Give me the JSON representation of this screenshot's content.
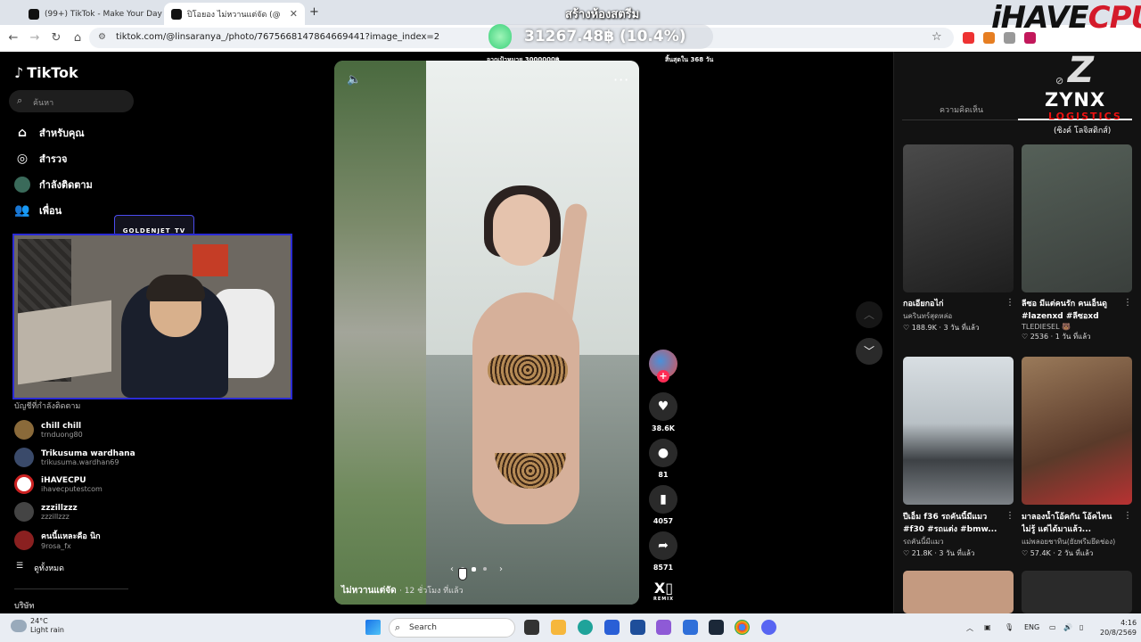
{
  "browser": {
    "tabs": [
      {
        "label": "(99+) TikTok - Make Your Day",
        "active": false
      },
      {
        "label": "ปิโอยอง ไม่หวานแต่จัด (@lins",
        "active": true
      }
    ],
    "new_tab_icon": "plus-icon",
    "url": "tiktok.com/@linsaranya_/photo/7675668147864669441?image_index=2"
  },
  "stream_overlay": {
    "donation_title": "สร้างห้องสตรีม",
    "donation_amount": "31267.48฿ (10.4%)",
    "donation_goal": "จากเป้าหมาย 3000000฿",
    "donation_deadline": "สิ้นสุดใน 368 วัน",
    "brand_main": "iHAVE",
    "brand_accent": "CPU",
    "sponsor_name": "ZYNX",
    "sponsor_sub": "LOGISTICS",
    "sponsor_thai": "(ซิงค์ โลจิสติกส์)",
    "webcam_tag": "GOLDENJET_TV"
  },
  "sidebar": {
    "logo": "TikTok",
    "search_placeholder": "ค้นหา",
    "nav": [
      {
        "label": "สำหรับคุณ",
        "icon": "home-icon"
      },
      {
        "label": "สำรวจ",
        "icon": "compass-icon"
      },
      {
        "label": "กำลังติดตาม",
        "icon": "following-avatar-icon"
      },
      {
        "label": "เพื่อน",
        "icon": "friends-icon"
      }
    ],
    "following_heading": "บัญชีที่กำลังติดตาม",
    "accounts": [
      {
        "name": "chill chill",
        "handle": "trnduong80",
        "color": "#8a6a3a"
      },
      {
        "name": "Trikusuma wardhana",
        "handle": "trikusuma.wardhan69",
        "color": "#3a4a6a"
      },
      {
        "name": "iHAVECPU",
        "handle": "ihavecputestcom",
        "color": "#ffffff"
      },
      {
        "name": "zzzillzzz",
        "handle": "zzzillzzz",
        "color": "#444444"
      },
      {
        "name": "คนนี้แหละคือ นิก",
        "handle": "9rosa_fx",
        "color": "#8a2020"
      }
    ],
    "see_all": "ดูทั้งหมด",
    "company": "บริษัท"
  },
  "post": {
    "caption_author": "ไม่หวานแต่จัด",
    "caption_time": "· 12 ชั่วโมง ที่แล้ว",
    "slide_count": 3,
    "slide_active": 1,
    "likes": "38.6K",
    "comments": "81",
    "bookmarks": "4057",
    "shares": "8571",
    "remix_label": "REMIX"
  },
  "right_panel": {
    "tab_comments": "ความคิดเห็น",
    "videos": [
      {
        "title": "กอเอียกอไก่",
        "author": "นครินทร์สุดหล่อ",
        "stats": "♡ 188.9K · 3 วัน ที่แล้ว",
        "colors": [
          "#2d2d2d",
          "#555"
        ]
      },
      {
        "title": "ลีซอ มีแต่คนรัก คนเอ็นดู #lazenxd #ลีซอxd #มา...",
        "author": "TLEDIESEL 🐻",
        "stats": "♡ 2536 · 1 วัน ที่แล้ว",
        "colors": [
          "#3f4a44",
          "#6a6a6a"
        ]
      },
      {
        "title": "ปีเอ็ม f36 รถคันนี้มีแมว #f30 #รถแต่ง #bmw...",
        "author": "รถคันนี้มีแมว",
        "stats": "♡ 21.8K · 3 วัน ที่แล้ว",
        "colors": [
          "#c9d4dc",
          "#4a4e52"
        ]
      },
      {
        "title": "มาลองน้ำโอ้คกัน โอ้คไหนไม่รู้ แต่ได้มาแล้ว...",
        "author": "แม่พลอยชาทิน(ยัยพรีมยึดช่อง)",
        "stats": "♡ 57.4K · 2 วัน ที่แล้ว",
        "colors": [
          "#8a6a4a",
          "#c44"
        ]
      }
    ]
  },
  "taskbar": {
    "weather_temp": "24°C",
    "weather_desc": "Light rain",
    "search_label": "Search",
    "lang": "ENG",
    "time": "4:16",
    "date": "20/8/2569"
  }
}
